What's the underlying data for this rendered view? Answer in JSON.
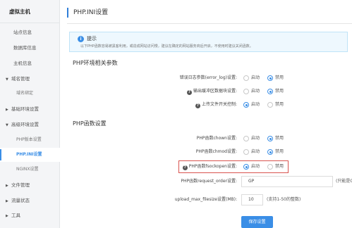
{
  "sidebar": {
    "header": "虚拟主机",
    "items": [
      {
        "label": "站点信息"
      },
      {
        "label": "数据库信息"
      },
      {
        "label": "主机信息"
      },
      {
        "label": "域名管理"
      },
      {
        "label": "域名绑定"
      },
      {
        "label": "基础环境设置"
      },
      {
        "label": "高级环境设置"
      },
      {
        "label": "PHP版本设置"
      },
      {
        "label": "PHP.INI设置"
      },
      {
        "label": "NGINX设置"
      },
      {
        "label": "文件管理"
      },
      {
        "label": "流量状态"
      },
      {
        "label": "工具"
      }
    ]
  },
  "page": {
    "title": "PHP.INI设置"
  },
  "tip": {
    "title": "提示",
    "text": "以下PHP函数容易被黑客利用，或造成网站访问慢，建议在确定的网站服务商后开启，不使用时建议关闭函数。"
  },
  "env_section": {
    "title": "PHP环境相关参数",
    "rows": [
      {
        "label": "错误日志参数(error_log)设置:",
        "on_label": "启动",
        "off_label": "禁用",
        "selected": "off"
      },
      {
        "label": "输出缓冲区数据块设置:",
        "on_label": "启动",
        "off_label": "禁用",
        "selected": "off"
      },
      {
        "label": "上传文件开关控制:",
        "on_label": "启动",
        "off_label": "禁用",
        "selected": "on"
      }
    ]
  },
  "func_section": {
    "title": "PHP函数设置",
    "rows": [
      {
        "label": "PHP函数chown设置:",
        "on_label": "启动",
        "off_label": "禁用",
        "selected": "off"
      },
      {
        "label": "PHP函数chmod设置:",
        "on_label": "启动",
        "off_label": "禁用",
        "selected": "off"
      },
      {
        "label": "PHP函数fsockopen设置:",
        "on_label": "启动",
        "off_label": "禁用",
        "selected": "on"
      }
    ],
    "request_order": {
      "label": "PHP函数request_order设置:",
      "value": "GP",
      "tip": "(只能是GPC组合"
    },
    "upload_max": {
      "label": "upload_max_filesize设置(MB):",
      "value": "10",
      "tip": "(支持1-50的整数)"
    }
  },
  "save_button": "保存设置",
  "colors": {
    "accent": "#3a8ee6",
    "highlight": "#d9534f"
  }
}
